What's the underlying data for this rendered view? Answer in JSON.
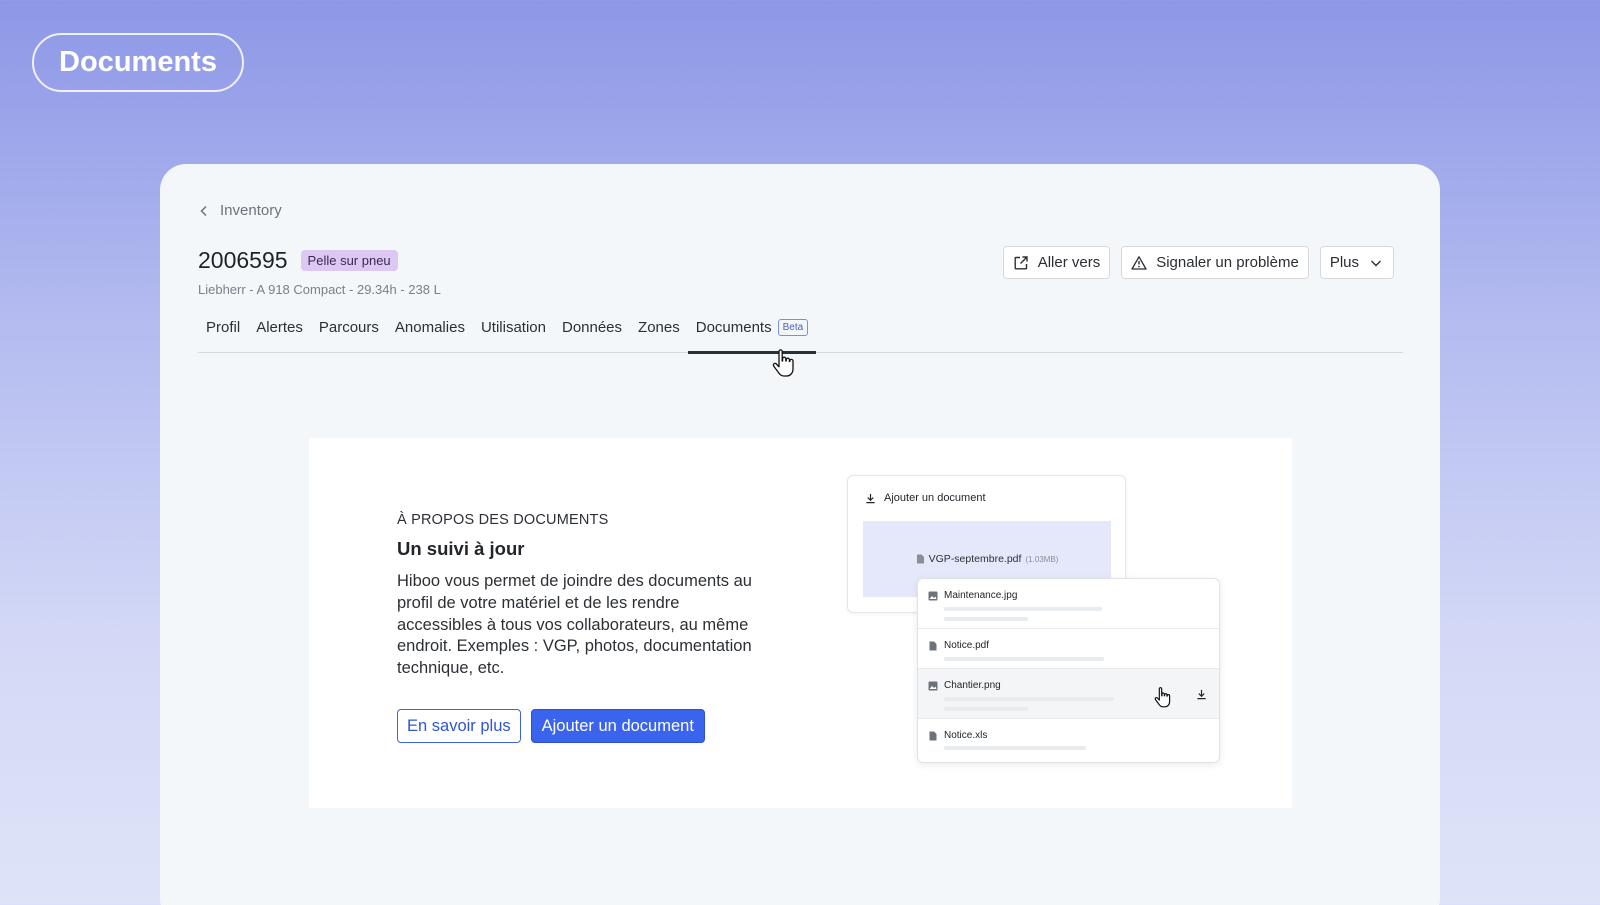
{
  "page_label": "Documents",
  "breadcrumb": {
    "label": "Inventory"
  },
  "asset": {
    "id": "2006595",
    "type": "Pelle sur pneu",
    "subtitle": "Liebherr - A 918 Compact - 29.34h - 238 L"
  },
  "actions": {
    "go_to": "Aller vers",
    "report": "Signaler un problème",
    "more": "Plus"
  },
  "tabs": [
    {
      "label": "Profil"
    },
    {
      "label": "Alertes"
    },
    {
      "label": "Parcours"
    },
    {
      "label": "Anomalies"
    },
    {
      "label": "Utilisation"
    },
    {
      "label": "Données"
    },
    {
      "label": "Zones"
    },
    {
      "label": "Documents",
      "badge": "Beta",
      "active": true
    }
  ],
  "empty_state": {
    "eyebrow": "À PROPOS DES DOCUMENTS",
    "headline": "Un suivi à jour",
    "description": "Hiboo vous permet de joindre des documents au profil de votre matériel et de les rendre accessibles à tous vos collaborateurs, au même endroit. Exemples : VGP, photos, documentation technique, etc.",
    "learn_more": "En savoir plus",
    "add_document": "Ajouter un document"
  },
  "illustration": {
    "upload_title": "Ajouter un document",
    "dropped_file": "VGP-septembre.pdf",
    "dropped_size": "(1.03MB)",
    "files": [
      {
        "name": "Maintenance.jpg",
        "icon": "image-icon"
      },
      {
        "name": "Notice.pdf",
        "icon": "file-icon"
      },
      {
        "name": "Chantier.png",
        "icon": "image-icon"
      },
      {
        "name": "Notice.xls",
        "icon": "file-icon"
      }
    ]
  },
  "colors": {
    "primary": "#3a63ee",
    "badge_purple": "#dcc8f3",
    "beta_blue": "#4a60c4",
    "dropzone": "#e5e8fb"
  }
}
